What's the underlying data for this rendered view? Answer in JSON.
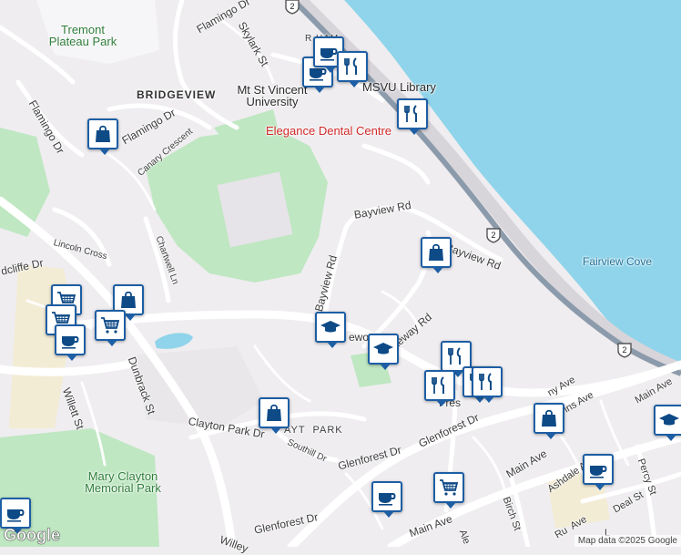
{
  "map": {
    "labels": {
      "tremont_park": "Tremont\nPlateau Park",
      "bridgeview": "BRIDGEVIEW",
      "msvu": "Mt St Vincent\nUniversity",
      "msvu_library": "MSVU Library",
      "elegance": "Elegance Dental Centre",
      "flamingo_dr_top": "Flamingo Dr",
      "skylark_st": "Skylark St",
      "flamingo_dr_left": "Flamingo Dr",
      "flamingo_dr_mid": "Flamingo Dr",
      "canary": "Canary Crescent",
      "lincoln": "Lincoln Cross",
      "chartwell": "Chartwell Ln",
      "cliffe": "dcliffe Dr",
      "bayview_rd_top": "Bayview Rd",
      "bayview_rd_right": "Bayview Rd",
      "bayview_rd_vert": "Bayview Rd",
      "fairview_cove": "Fairview Cove",
      "gateway": "Gateway Rd",
      "ewo": "ewo",
      "dunbrack": "Dunbrack St",
      "willett": "Willett St",
      "clayton_park_dr": "Clayton Park Dr",
      "clayton_park": "AYT  PARK",
      "southill": "Southill Dr",
      "glenforest1": "Glenforest Dr",
      "glenforest2": "Glenforest Dr",
      "glenforest3": "Glenforest Dr",
      "mary_clayton": "Mary Clayton\nMemorial Park",
      "main_ave1": "Main Ave",
      "main_ave2": "Main Ave",
      "main_ave3": "Main Ave",
      "birch": "Birch St",
      "ashdale": "Ashdale Ave",
      "percy": "Percy St",
      "deal": "Deal St",
      "ny_ave": "ny Ave",
      "ins_ave": "ins Ave",
      "rham": "R      HAM",
      "fres": "Fres",
      "willey": "Willey",
      "ale": "Ale",
      "rufus": "Ru  Ave",
      "lt": "L"
    },
    "route_shield": "2",
    "google_logo": "Google",
    "attribution": "Map data ©2025 Google",
    "colors": {
      "water": "#8fd4ea",
      "park": "#bfe7c2",
      "land": "#efedf0",
      "road": "#ffffff",
      "highway": "#8c9bab",
      "pin_border": "#1d5ea4",
      "pin_icon": "#0e4a86"
    },
    "markers": [
      {
        "type": "cafe-icon"
      },
      {
        "type": "cafe-icon"
      },
      {
        "type": "restaurant-icon"
      },
      {
        "type": "restaurant-icon"
      },
      {
        "type": "shopping-bag-icon"
      },
      {
        "type": "shopping-cart-icon"
      },
      {
        "type": "shopping-bag-icon"
      },
      {
        "type": "shopping-cart-icon"
      },
      {
        "type": "cafe-icon"
      },
      {
        "type": "shopping-cart-icon"
      },
      {
        "type": "school-icon"
      },
      {
        "type": "school-icon"
      },
      {
        "type": "shopping-bag-icon"
      },
      {
        "type": "restaurant-icon"
      },
      {
        "type": "restaurant-icon"
      },
      {
        "type": "restaurant-icon"
      },
      {
        "type": "restaurant-icon"
      },
      {
        "type": "shopping-bag-icon"
      },
      {
        "type": "school-icon"
      },
      {
        "type": "cafe-icon"
      },
      {
        "type": "shopping-bag-icon"
      },
      {
        "type": "shopping-cart-icon"
      },
      {
        "type": "cafe-icon"
      },
      {
        "type": "cafe-icon"
      }
    ]
  }
}
